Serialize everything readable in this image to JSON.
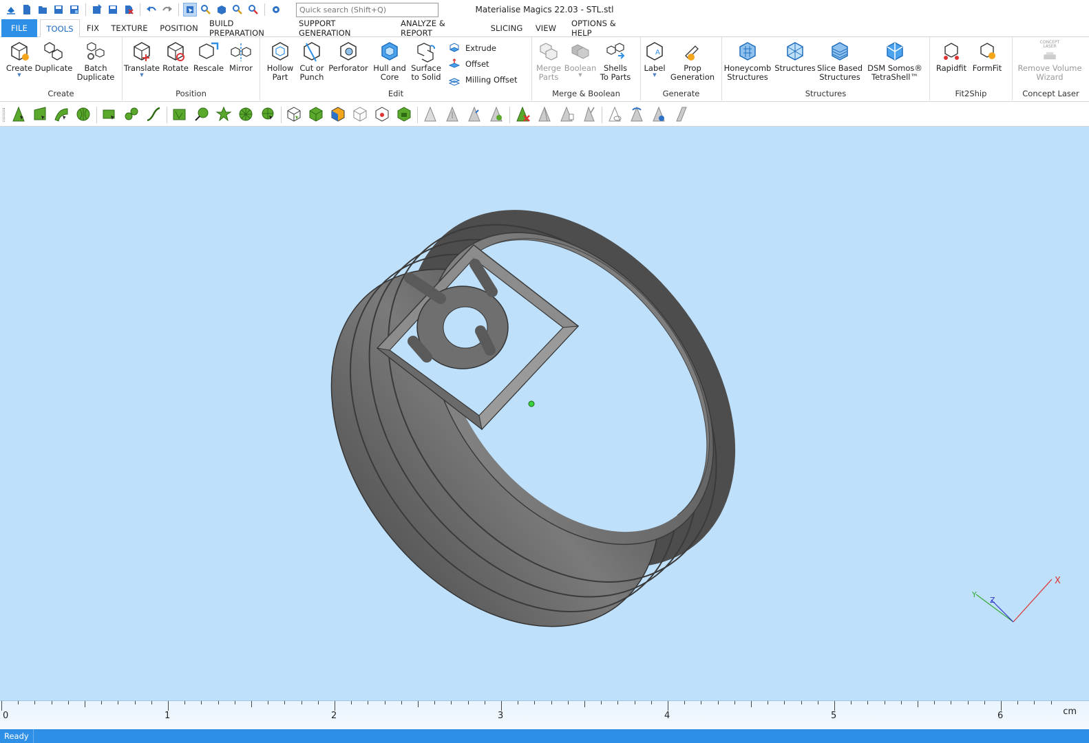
{
  "app": {
    "title": "Materialise Magics 22.03 - STL.stl",
    "search_placeholder": "Quick search (Shift+Q)",
    "accent_color": "#2e8fe6"
  },
  "quick_access": [
    "new-icon",
    "open-icon",
    "save-icon",
    "save-as-icon",
    "import-icon",
    "export-icon",
    "close-icon",
    "undo-icon",
    "redo-icon",
    "select-icon",
    "zoom-icon",
    "view-icon",
    "magnify-icon",
    "measure-icon",
    "settings-icon"
  ],
  "menu": {
    "tabs": [
      {
        "label": "FILE"
      },
      {
        "label": "TOOLS"
      },
      {
        "label": "FIX"
      },
      {
        "label": "TEXTURE"
      },
      {
        "label": "POSITION"
      },
      {
        "label": "BUILD PREPARATION"
      },
      {
        "label": "SUPPORT GENERATION"
      },
      {
        "label": "ANALYZE & REPORT"
      },
      {
        "label": "SLICING"
      },
      {
        "label": "VIEW"
      },
      {
        "label": "OPTIONS & HELP"
      }
    ]
  },
  "ribbon": {
    "groups": {
      "create": "Create",
      "position": "Position",
      "edit": "Edit",
      "merge": "Merge & Boolean",
      "generate": "Generate",
      "structures": "Structures",
      "fit2ship": "Fit2Ship",
      "concept": "Concept Laser"
    },
    "buttons": {
      "create": "Create",
      "duplicate": "Duplicate",
      "batch_duplicate": "Batch\nDuplicate",
      "translate": "Translate",
      "rotate": "Rotate",
      "rescale": "Rescale",
      "mirror": "Mirror",
      "hollow": "Hollow\nPart",
      "cut": "Cut or\nPunch",
      "perforator": "Perforator",
      "hull": "Hull and\nCore",
      "surface": "Surface\nto Solid",
      "extrude": "Extrude",
      "offset": "Offset",
      "milling": "Milling Offset",
      "merge_parts": "Merge\nParts",
      "boolean": "Boolean",
      "shells": "Shells\nTo Parts",
      "label": "Label",
      "prop": "Prop\nGeneration",
      "honeycomb": "Honeycomb\nStructures",
      "structures": "Structures",
      "slice_based": "Slice Based\nStructures",
      "dsm": "DSM Somos®\nTetraShell™",
      "rapidfit": "Rapidfit",
      "formfit": "FormFit",
      "remove_volume": "Remove Volume\nWizard",
      "concept_laser_logo": "CONCEPT\nLASER"
    }
  },
  "viewport": {
    "background": "#bfe0fa",
    "model_color": "#6e6e6e",
    "axes": {
      "x": "X",
      "y": "Y",
      "z": "Z"
    }
  },
  "ruler": {
    "labels": [
      "0",
      "1",
      "2",
      "3",
      "4",
      "5",
      "6"
    ],
    "unit": "cm"
  },
  "status": {
    "text": "Ready"
  }
}
